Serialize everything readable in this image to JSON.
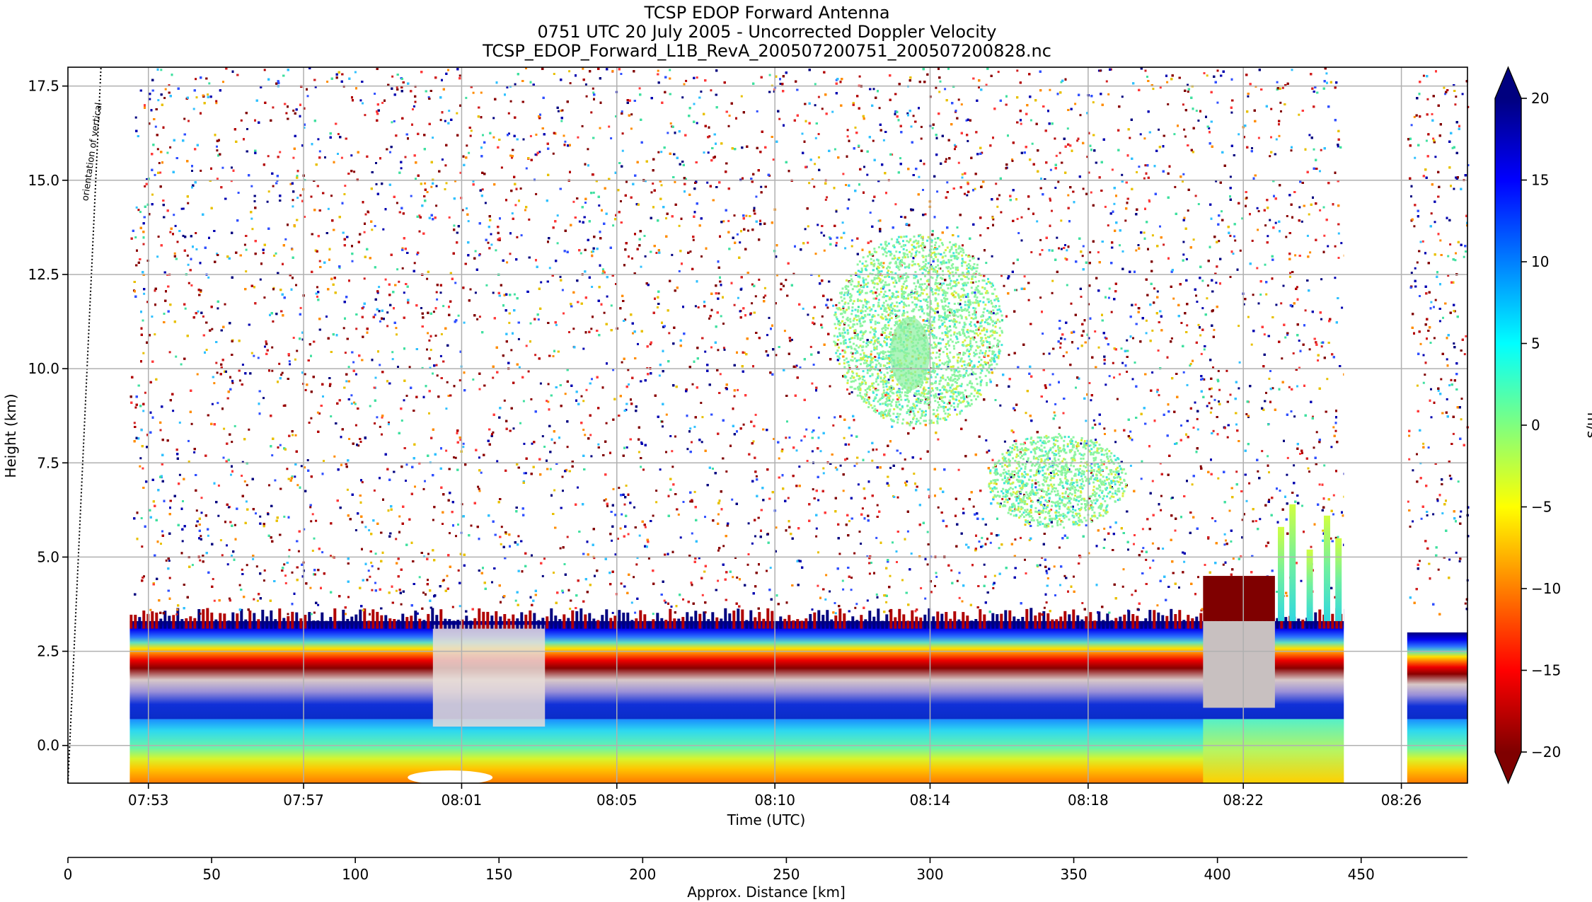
{
  "chart_data": {
    "type": "heatmap",
    "title_lines": [
      "TCSP EDOP Forward Antenna",
      "0751 UTC 20 July 2005 - Uncorrected Doppler Velocity",
      "TCSP_EDOP_Forward_L1B_RevA_200507200751_200507200828.nc"
    ],
    "xlabel": "Time (UTC)",
    "ylabel": "Height (km)",
    "x2label": "Approx. Distance [km]",
    "colorbar_label": "m/s",
    "annotation": "orientation of vertical",
    "x_time_ticks": [
      "07:53",
      "07:57",
      "08:01",
      "08:05",
      "08:10",
      "08:14",
      "08:18",
      "08:22",
      "08:26"
    ],
    "x_time_tick_distances_km": [
      28,
      82,
      137,
      191,
      246,
      300,
      355,
      409,
      464
    ],
    "y_ticks": [
      0.0,
      2.5,
      5.0,
      7.5,
      10.0,
      12.5,
      15.0,
      17.5
    ],
    "y_tick_labels": [
      "0.0",
      "2.5",
      "5.0",
      "7.5",
      "10.0",
      "12.5",
      "15.0",
      "17.5"
    ],
    "ylim": [
      -1.0,
      18.0
    ],
    "x_distance_ticks": [
      0,
      50,
      100,
      150,
      200,
      250,
      300,
      350,
      400,
      450
    ],
    "x_distance_range_km": [
      0,
      487
    ],
    "colorbar_ticks": [
      20,
      15,
      10,
      5,
      0,
      -5,
      -10,
      -15,
      -20
    ],
    "colorbar_tick_labels": [
      "20",
      "15",
      "10",
      "5",
      "0",
      "−5",
      "−10",
      "−15",
      "−20"
    ],
    "colorbar_range": [
      -20,
      20
    ],
    "colormap": "jet",
    "grid": true,
    "data_gaps_km": [
      [
        0,
        21.5
      ],
      [
        444,
        466
      ]
    ],
    "features": [
      {
        "kind": "surface_band",
        "x_km": [
          21.5,
          487
        ],
        "height_km": [
          -1.0,
          0.7
        ],
        "velocity_ms": [
          -10,
          8
        ]
      },
      {
        "kind": "low_level_layer",
        "x_km": [
          21.5,
          444
        ],
        "height_km": [
          0.7,
          3.3
        ],
        "velocity_ms": [
          -20,
          20
        ]
      },
      {
        "kind": "noise_region",
        "x_km": [
          21.5,
          487
        ],
        "height_km": [
          3.5,
          18.0
        ]
      },
      {
        "kind": "cloud_echo",
        "x_km": [
          266,
          325
        ],
        "height_km": [
          8.5,
          13.6
        ],
        "velocity_ms": [
          -2,
          6
        ]
      },
      {
        "kind": "cloud_echo",
        "x_km": [
          320,
          368
        ],
        "height_km": [
          5.8,
          8.3
        ],
        "velocity_ms": [
          -2,
          4
        ]
      },
      {
        "kind": "convective_cells",
        "x_km": [
          395,
          444
        ],
        "height_km": [
          1.0,
          6.5
        ],
        "velocity_ms": [
          -20,
          6
        ]
      }
    ]
  }
}
